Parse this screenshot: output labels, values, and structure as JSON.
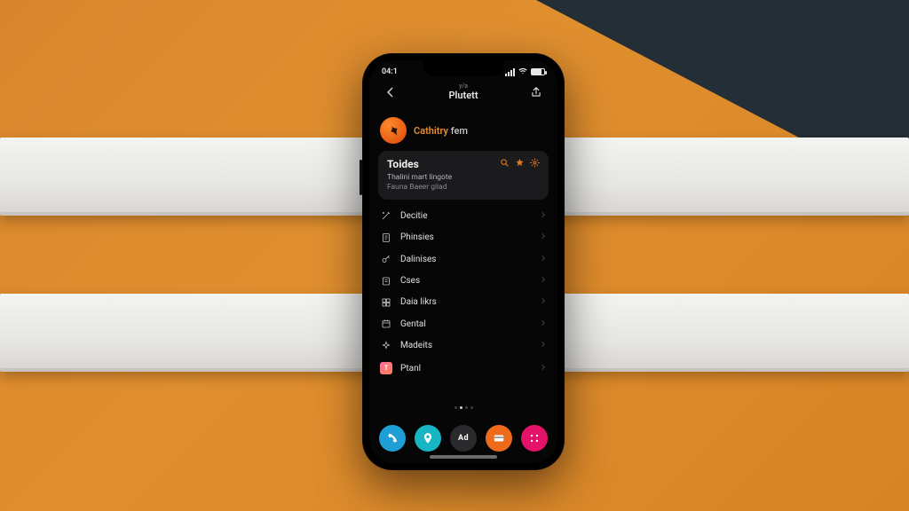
{
  "colors": {
    "accent_orange": "#e67a1f",
    "dock": {
      "phone": "#1ea0d6",
      "location": "#18b6c4",
      "ad": "#2b2b2e",
      "card": "#ef6b1c",
      "apps": "#e4136a"
    }
  },
  "status_bar": {
    "time": "04:1",
    "battery_pct": 75
  },
  "header": {
    "subtitle": "y/a",
    "title": "Plutett"
  },
  "profile": {
    "name_accent": "Cathitry",
    "name_rest": " fem"
  },
  "card": {
    "title": "Toides",
    "glyphs": {
      "search": "search-icon",
      "star": "star-icon",
      "gear": "gear-icon"
    },
    "subtitle_line1": "Thalini mart lingote",
    "subtitle_line2": "Fauna Baeer gilad"
  },
  "menu": [
    {
      "icon": "wand-icon",
      "label": "Decitie"
    },
    {
      "icon": "note-icon",
      "label": "Phinsies"
    },
    {
      "icon": "key-icon",
      "label": "Dalinises"
    },
    {
      "icon": "doc-icon",
      "label": "Cses"
    },
    {
      "icon": "grid-icon",
      "label": "Daia likrs"
    },
    {
      "icon": "calendar-icon",
      "label": "Gental"
    },
    {
      "icon": "sparkle-icon",
      "label": "Madeits"
    },
    {
      "icon": "app-tile-icon",
      "label": "Ptanl"
    }
  ],
  "dock": [
    {
      "name": "phone",
      "icon": "phone-icon"
    },
    {
      "name": "location",
      "icon": "location-icon"
    },
    {
      "name": "ad",
      "icon": "ad-icon"
    },
    {
      "name": "card",
      "icon": "card-icon"
    },
    {
      "name": "apps",
      "icon": "apps-icon"
    }
  ]
}
